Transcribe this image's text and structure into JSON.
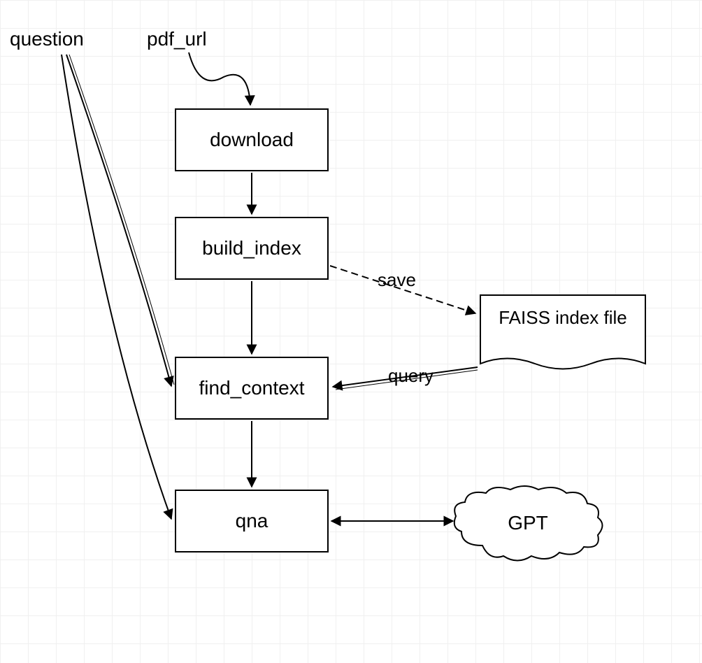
{
  "inputs": {
    "question": "question",
    "pdf_url": "pdf_url"
  },
  "nodes": {
    "download": "download",
    "build_index": "build_index",
    "find_context": "find_context",
    "qna": "qna",
    "faiss": "FAISS index file",
    "gpt": "GPT"
  },
  "edges": {
    "save": "save",
    "query": "query"
  }
}
